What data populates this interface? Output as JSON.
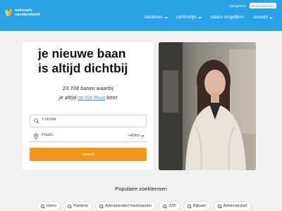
{
  "brand": {
    "name_line1": "nationale",
    "name_line2": "vacaturebank"
  },
  "top_links": {
    "werkgevers": "werkgevers",
    "cta": "werkzoekenden"
  },
  "nav": [
    {
      "label": "vacatures"
    },
    {
      "label": "carrièretips"
    },
    {
      "label": "salaris vergelijken"
    },
    {
      "label": "account"
    }
  ],
  "hero": {
    "headline_line1": "je nieuwe baan",
    "headline_line2": "is altijd dichtbij",
    "sub_line1": "23.708 banen waarbij",
    "sub_line2_prefix": "je altijd ",
    "sub_line2_highlight": "op tijd thuis",
    "sub_line2_suffix": " bent"
  },
  "search": {
    "function_placeholder": "Functie",
    "place_placeholder": "Plaats",
    "radius_value": "+40km",
    "button_label": "zoeken"
  },
  "popular": {
    "title": "Populaire zoektermen",
    "chips": [
      "Intern",
      "Parttime",
      "Administratief medewerker",
      "ZZP",
      "Bijbaan",
      "Administratief"
    ]
  },
  "colors": {
    "header": "#2aa3e6",
    "accent": "#f7941d",
    "highlight": "#2aa3e6"
  }
}
